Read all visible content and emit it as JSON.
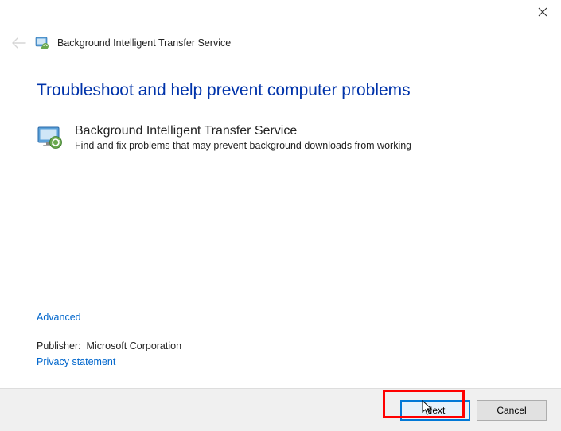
{
  "titlebar": {
    "close_tooltip": "Close"
  },
  "header": {
    "title": "Background Intelligent Transfer Service"
  },
  "main": {
    "heading": "Troubleshoot and help prevent computer problems",
    "item_title": "Background Intelligent Transfer Service",
    "item_desc": "Find and fix problems that may prevent background downloads from working"
  },
  "links": {
    "advanced": "Advanced",
    "publisher_label": "Publisher:",
    "publisher_value": "Microsoft Corporation",
    "privacy": "Privacy statement"
  },
  "footer": {
    "next": "Next",
    "cancel": "Cancel"
  }
}
